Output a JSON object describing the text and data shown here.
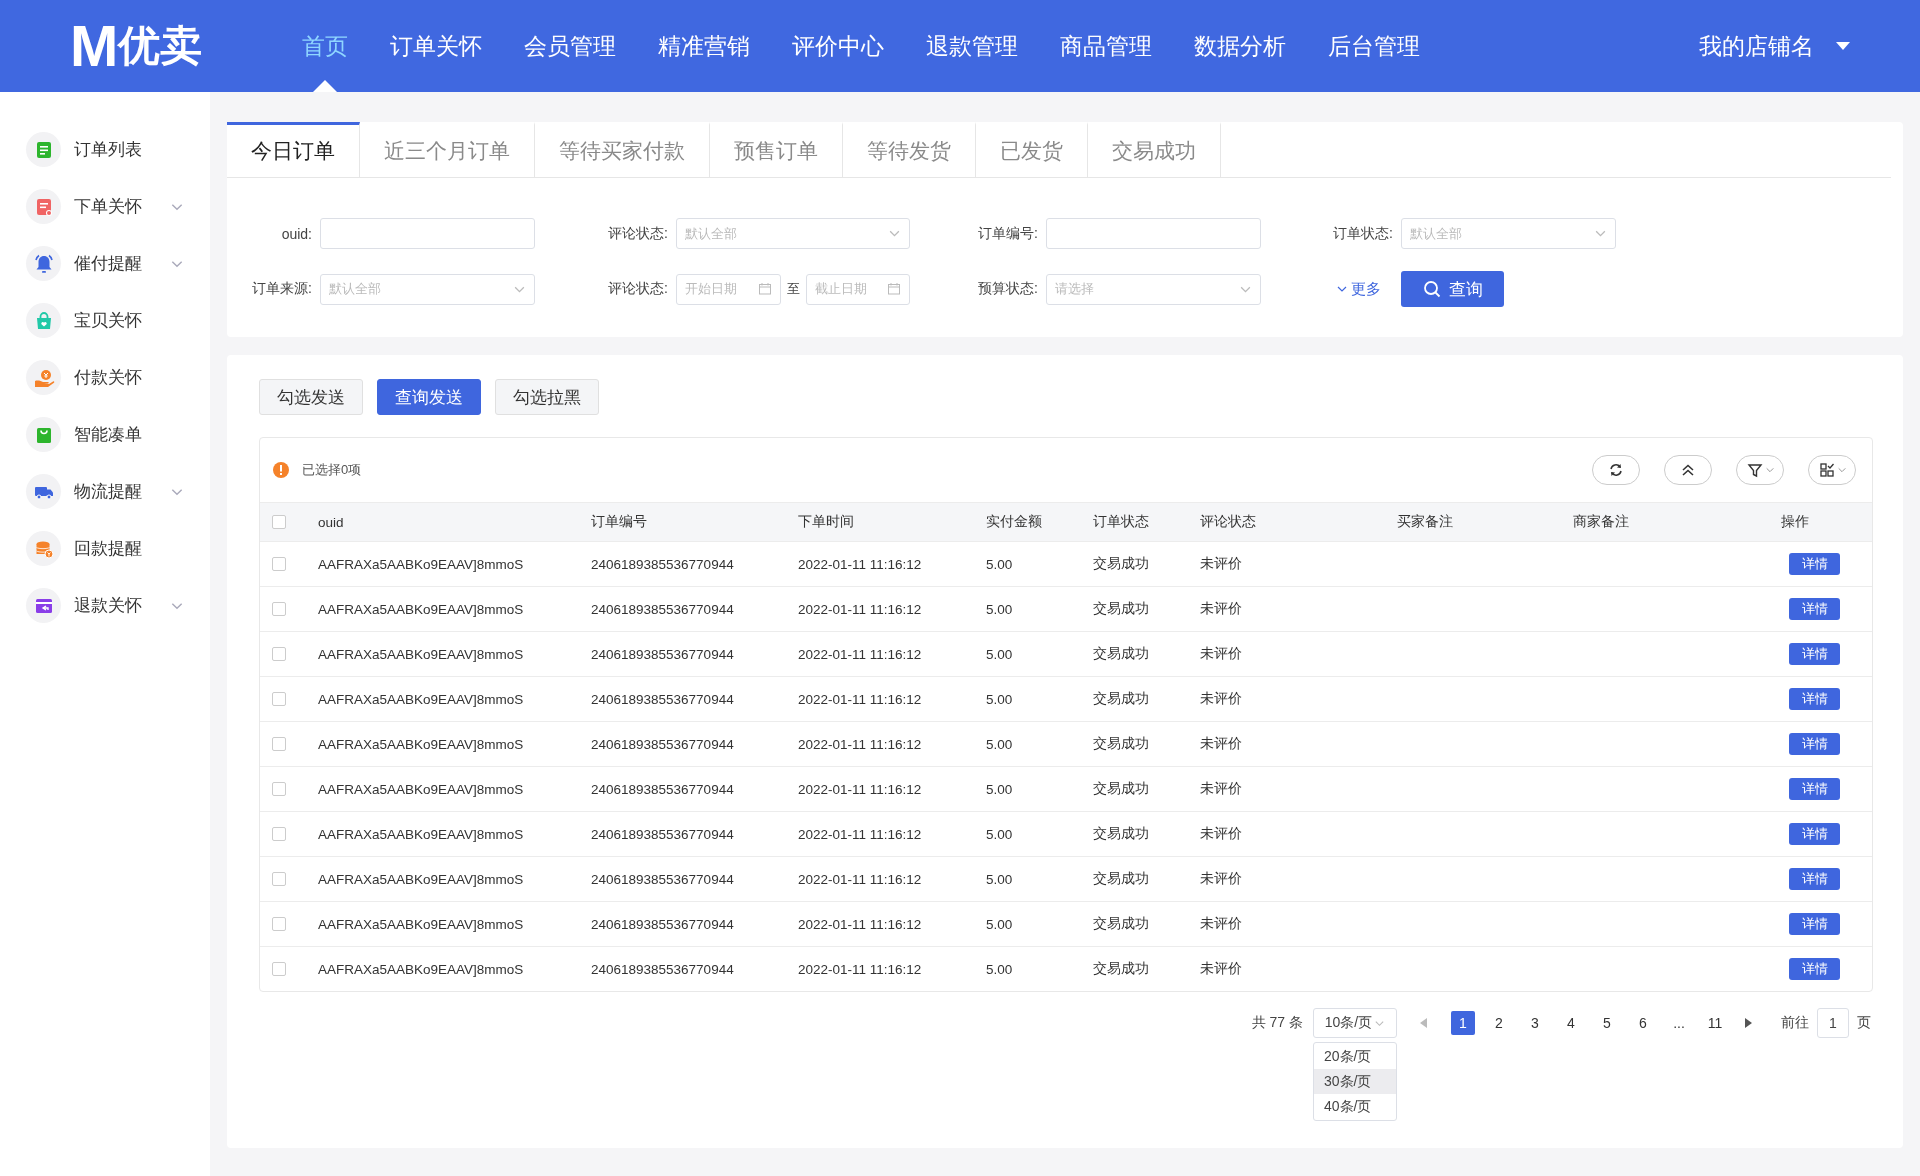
{
  "header": {
    "logo_mark": "M",
    "logo_text": "优卖",
    "nav": [
      {
        "label": "首页",
        "selected": true
      },
      {
        "label": "订单关怀",
        "selected": false
      },
      {
        "label": "会员管理",
        "selected": false
      },
      {
        "label": "精准营销",
        "selected": false
      },
      {
        "label": "评价中心",
        "selected": false
      },
      {
        "label": "退款管理",
        "selected": false
      },
      {
        "label": "商品管理",
        "selected": false
      },
      {
        "label": "数据分析",
        "selected": false
      },
      {
        "label": "后台管理",
        "selected": false
      }
    ],
    "store_name": "我的店铺名"
  },
  "sidebar": {
    "items": [
      {
        "label": "订单列表",
        "expandable": false
      },
      {
        "label": "下单关怀",
        "expandable": true
      },
      {
        "label": "催付提醒",
        "expandable": true
      },
      {
        "label": "宝贝关怀",
        "expandable": false
      },
      {
        "label": "付款关怀",
        "expandable": false
      },
      {
        "label": "智能凑单",
        "expandable": false
      },
      {
        "label": "物流提醒",
        "expandable": true
      },
      {
        "label": "回款提醒",
        "expandable": false
      },
      {
        "label": "退款关怀",
        "expandable": true
      }
    ]
  },
  "tabs": [
    {
      "label": "今日订单",
      "selected": true
    },
    {
      "label": "近三个月订单",
      "selected": false
    },
    {
      "label": "等待买家付款",
      "selected": false
    },
    {
      "label": "预售订单",
      "selected": false
    },
    {
      "label": "等待发货",
      "selected": false
    },
    {
      "label": "已发货",
      "selected": false
    },
    {
      "label": "交易成功",
      "selected": false
    }
  ],
  "filters": [
    {
      "kind": "text",
      "label": "ouid:"
    },
    {
      "kind": "select",
      "label": "评论状态:",
      "placeholder": "默认全部"
    },
    {
      "kind": "text",
      "label": "订单编号:"
    },
    {
      "kind": "select",
      "label": "订单状态:",
      "placeholder": "默认全部"
    },
    {
      "kind": "select",
      "label": "订单来源:",
      "placeholder": "默认全部"
    },
    {
      "kind": "daterange",
      "label": "评论状态:",
      "start_placeholder": "开始日期",
      "separator": "至",
      "end_placeholder": "截止日期"
    },
    {
      "kind": "select",
      "label": "预算状态:",
      "placeholder": "请选择"
    }
  ],
  "more_link": "更多",
  "search_button": "查询",
  "actions": [
    {
      "label": "勾选发送",
      "primary": false
    },
    {
      "label": "查询发送",
      "primary": true
    },
    {
      "label": "勾选拉黑",
      "primary": false
    }
  ],
  "table": {
    "selection_info": "已选择0项",
    "select_all_checked": false,
    "columns": [
      "ouid",
      "订单编号",
      "下单时间",
      "实付金额",
      "订单状态",
      "评论状态",
      "买家备注",
      "商家备注",
      "操作"
    ],
    "rows": [
      {
        "checked": false,
        "cells": [
          "AAFRAXa5AABKo9EAAV]8mmoS",
          "2406189385536770944",
          "2022-01-11 11:16:12",
          "5.00",
          "交易成功",
          "未评价"
        ],
        "action": "详情"
      },
      {
        "checked": false,
        "cells": [
          "AAFRAXa5AABKo9EAAV]8mmoS",
          "2406189385536770944",
          "2022-01-11 11:16:12",
          "5.00",
          "交易成功",
          "未评价"
        ],
        "action": "详情"
      },
      {
        "checked": false,
        "cells": [
          "AAFRAXa5AABKo9EAAV]8mmoS",
          "2406189385536770944",
          "2022-01-11 11:16:12",
          "5.00",
          "交易成功",
          "未评价"
        ],
        "action": "详情"
      },
      {
        "checked": false,
        "cells": [
          "AAFRAXa5AABKo9EAAV]8mmoS",
          "2406189385536770944",
          "2022-01-11 11:16:12",
          "5.00",
          "交易成功",
          "未评价"
        ],
        "action": "详情"
      },
      {
        "checked": false,
        "cells": [
          "AAFRAXa5AABKo9EAAV]8mmoS",
          "2406189385536770944",
          "2022-01-11 11:16:12",
          "5.00",
          "交易成功",
          "未评价"
        ],
        "action": "详情"
      },
      {
        "checked": false,
        "cells": [
          "AAFRAXa5AABKo9EAAV]8mmoS",
          "2406189385536770944",
          "2022-01-11 11:16:12",
          "5.00",
          "交易成功",
          "未评价"
        ],
        "action": "详情"
      },
      {
        "checked": false,
        "cells": [
          "AAFRAXa5AABKo9EAAV]8mmoS",
          "2406189385536770944",
          "2022-01-11 11:16:12",
          "5.00",
          "交易成功",
          "未评价"
        ],
        "action": "详情"
      },
      {
        "checked": false,
        "cells": [
          "AAFRAXa5AABKo9EAAV]8mmoS",
          "2406189385536770944",
          "2022-01-11 11:16:12",
          "5.00",
          "交易成功",
          "未评价"
        ],
        "action": "详情"
      },
      {
        "checked": false,
        "cells": [
          "AAFRAXa5AABKo9EAAV]8mmoS",
          "2406189385536770944",
          "2022-01-11 11:16:12",
          "5.00",
          "交易成功",
          "未评价"
        ],
        "action": "详情"
      },
      {
        "checked": false,
        "cells": [
          "AAFRAXa5AABKo9EAAV]8mmoS",
          "2406189385536770944",
          "2022-01-11 11:16:12",
          "5.00",
          "交易成功",
          "未评价"
        ],
        "action": "详情"
      }
    ]
  },
  "pagination": {
    "total": "共 77 条",
    "page_size": "10条/页",
    "page_size_options": [
      {
        "label": "20条/页",
        "highlighted": false
      },
      {
        "label": "30条/页",
        "highlighted": true
      },
      {
        "label": "40条/页",
        "highlighted": false
      }
    ],
    "pages": [
      {
        "label": "1",
        "selected": true
      },
      {
        "label": "2",
        "selected": false
      },
      {
        "label": "3",
        "selected": false
      },
      {
        "label": "4",
        "selected": false
      },
      {
        "label": "5",
        "selected": false
      },
      {
        "label": "6",
        "selected": false
      },
      {
        "label": "...",
        "selected": false
      },
      {
        "label": "11",
        "selected": false
      }
    ],
    "goto_label": "前往",
    "goto_value": "1",
    "page_suffix": "页"
  }
}
